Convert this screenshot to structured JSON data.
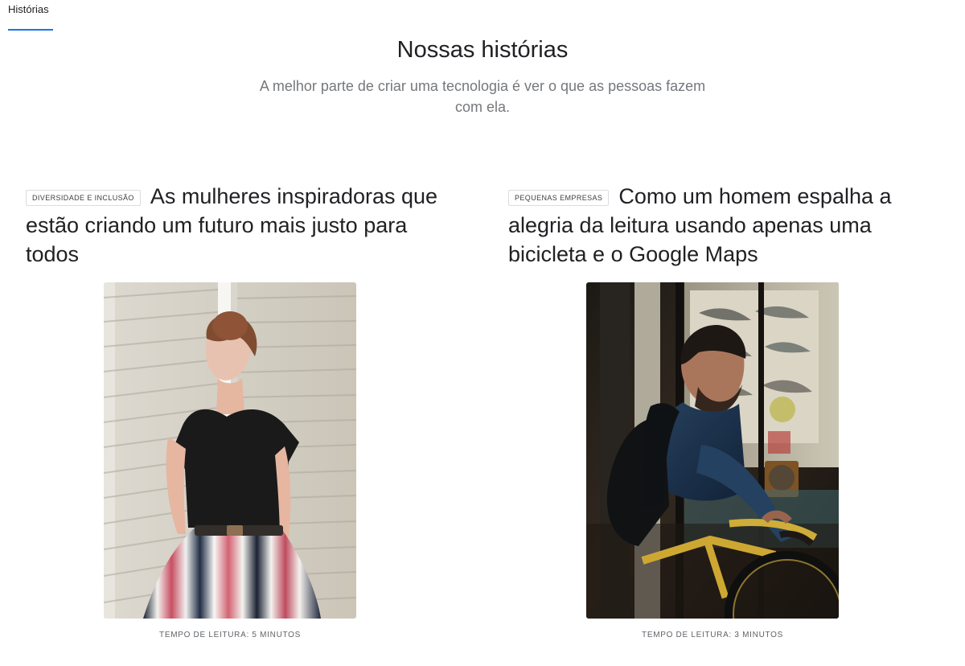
{
  "tabs": {
    "active": "Histórias"
  },
  "hero": {
    "title": "Nossas histórias",
    "subtitle": "A melhor parte de criar uma tecnologia é ver o que as pessoas fazem com ela."
  },
  "stories": [
    {
      "category": "Diversidade e inclusão",
      "title": "As mulheres inspiradoras que estão criando um futuro mais justo para todos",
      "reading_time": "Tempo de leitura: 5 minutos",
      "image_icon": "woman-portrait-photo"
    },
    {
      "category": "Pequenas empresas",
      "title": "Como um homem espalha a alegria da leitura usando apenas uma bicicleta e o Google Maps",
      "reading_time": "Tempo de leitura: 3 minutos",
      "image_icon": "man-bicycle-photo"
    }
  ],
  "colors": {
    "accent": "#1a73e8",
    "text": "#202124",
    "muted": "#5f6368",
    "border": "#dadce0"
  }
}
